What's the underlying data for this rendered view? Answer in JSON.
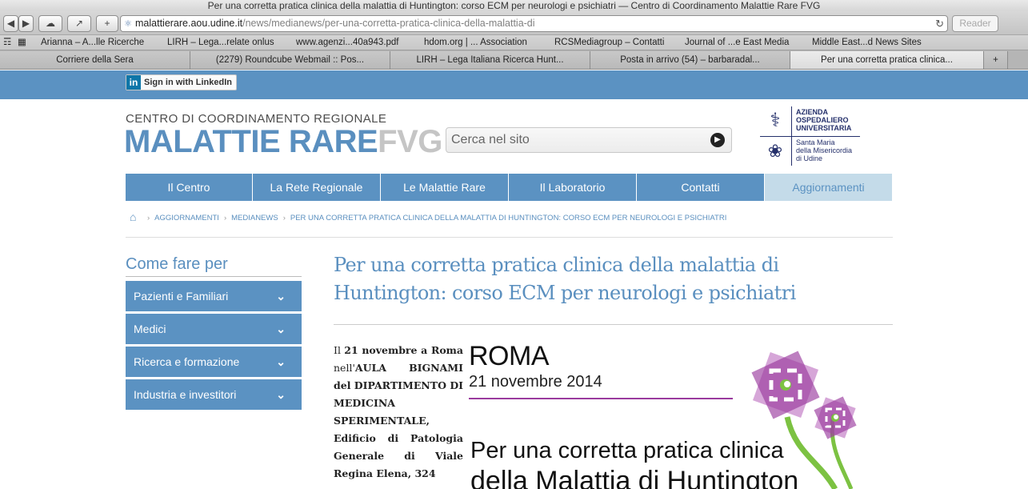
{
  "browser": {
    "window_title": "Per una corretta pratica clinica della malattia di Huntington: corso ECM per neurologi e psichiatri — Centro di Coordinamento Malattie Rare FVG",
    "url_host": "malattierare.aou.udine.it",
    "url_path": "/news/medianews/per-una-corretta-pratica-clinica-della-malattia-di",
    "reader_label": "Reader",
    "bookmarks": [
      "Arianna – A...lle Ricerche",
      "LIRH – Lega...relate onlus",
      "www.agenzi...40a943.pdf",
      "hdom.org | ... Association",
      "RCSMediagroup – Contatti",
      "Journal of ...e East Media",
      "Middle East...d News Sites"
    ],
    "tabs": [
      "Corriere della Sera",
      "(2279) Roundcube Webmail :: Pos...",
      "LIRH – Lega Italiana Ricerca Hunt...",
      "Posta in arrivo (54) – barbaradal...",
      "Per una corretta pratica clinica..."
    ]
  },
  "linkedin": {
    "label": "Sign in with LinkedIn",
    "logo": "in"
  },
  "header": {
    "subtitle": "CENTRO DI COORDINAMENTO REGIONALE",
    "logo_main": "MALATTIE RARE",
    "logo_suffix": "FVG",
    "search_placeholder": "Cerca nel sito",
    "hospital_line1": "AZIENDA",
    "hospital_line2": "OSPEDALIERO",
    "hospital_line3": "UNIVERSITARIA",
    "hospital_line4": "Santa Maria",
    "hospital_line5": "della Misericordia",
    "hospital_line6": "di Udine"
  },
  "nav": [
    "Il Centro",
    "La Rete Regionale",
    "Le Malattie Rare",
    "Il Laboratorio",
    "Contatti",
    "Aggiornamenti"
  ],
  "breadcrumb": [
    "AGGIORNAMENTI",
    "MEDIANEWS",
    "PER UNA CORRETTA PRATICA CLINICA DELLA MALATTIA DI HUNTINGTON: CORSO ECM PER NEUROLOGI E PSICHIATRI"
  ],
  "sidebar": {
    "title": "Come fare per",
    "items": [
      "Pazienti e Familiari",
      "Medici",
      "Ricerca e formazione",
      "Industria e investitori"
    ]
  },
  "article": {
    "title": "Per una corretta pratica clinica della malattia di Huntington: corso ECM per neurologi e psichiatri",
    "text_p1": "Il ",
    "text_b1": "21 novembre a Roma",
    "text_p2": " nell'",
    "text_b2": "AULA BIGNAMI del DIPARTIMENTO DI MEDICINA SPERIMENTALE,",
    "text_p3": " Edificio di Patologia Generale di Viale Regina Elena, 324",
    "poster_city": "ROMA",
    "poster_date": "21 novembre 2014",
    "poster_title_1": "Per una corretta pratica clinica",
    "poster_title_2": "della Malattia di Huntington"
  },
  "colors": {
    "brand_blue": "#5b92c2",
    "nav_active_bg": "#c4dbe9",
    "poster_purple": "#8e2d94",
    "poster_green": "#7cc242"
  }
}
